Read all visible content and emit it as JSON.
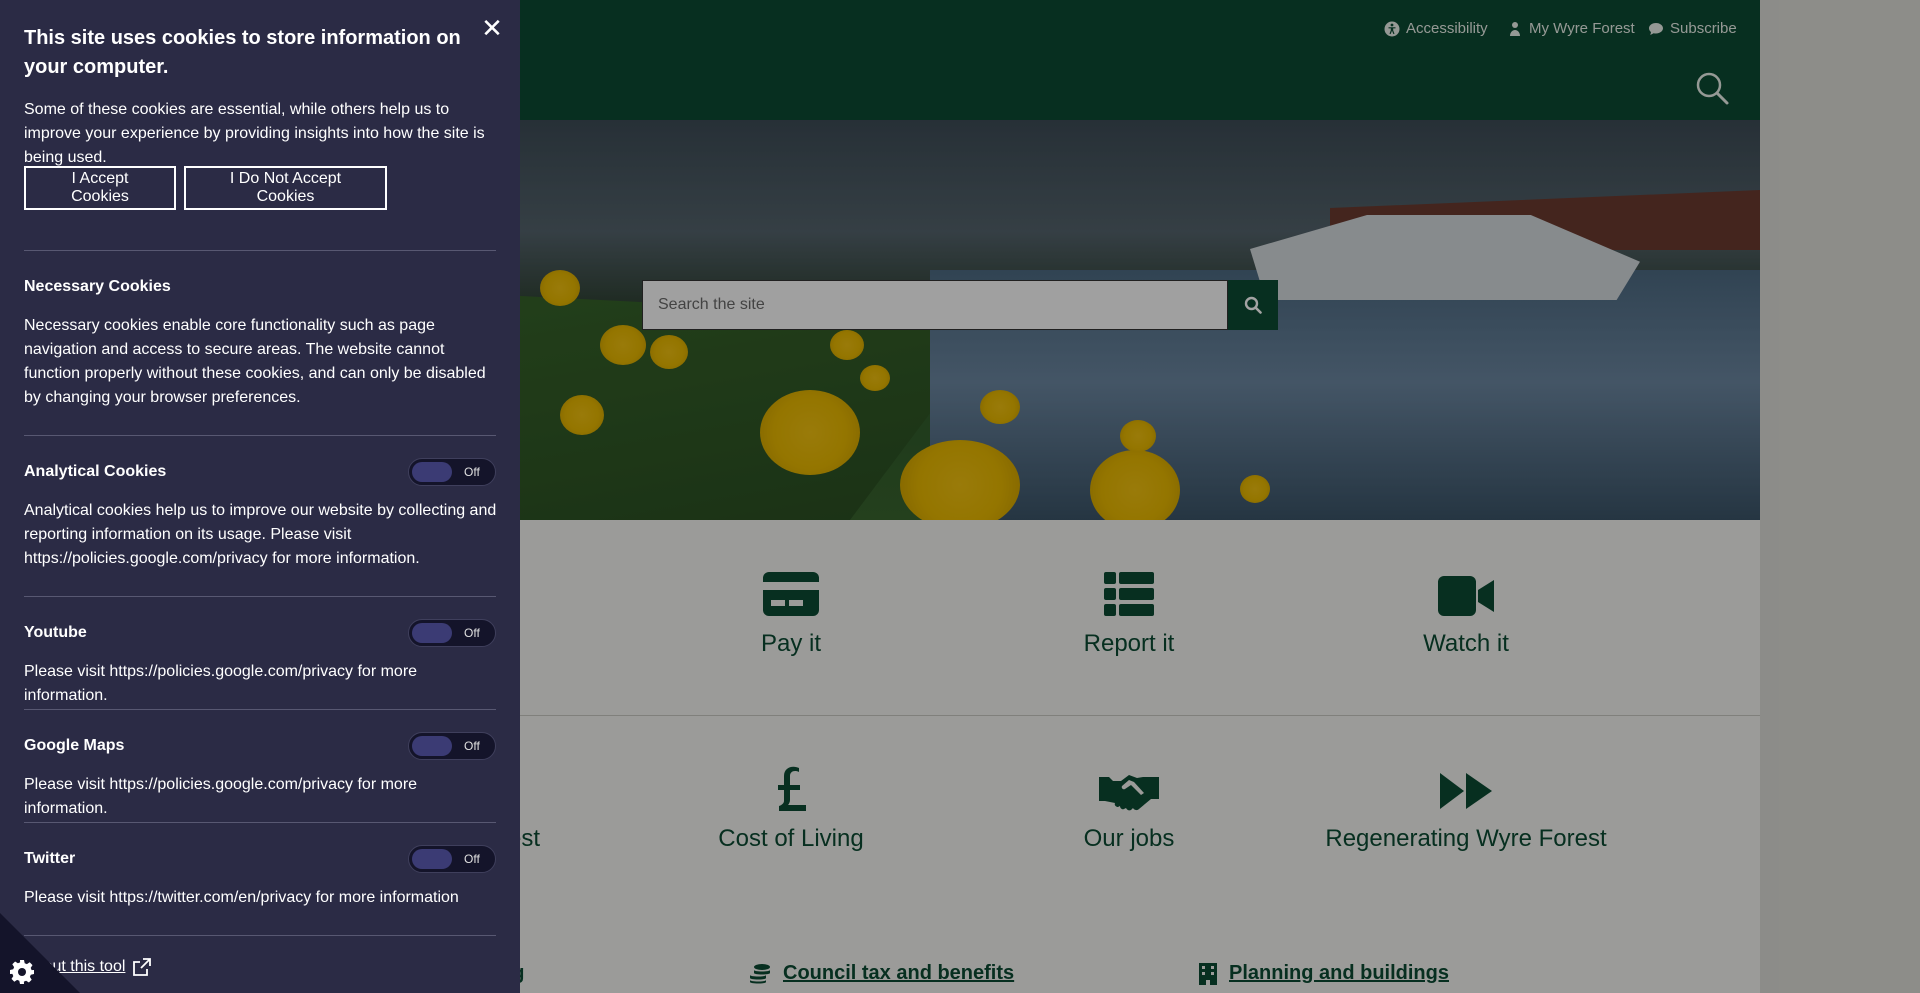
{
  "header": {
    "utility": [
      {
        "label": "Accessibility",
        "icon": "accessibility-icon"
      },
      {
        "label": "My Wyre Forest",
        "icon": "user-icon"
      },
      {
        "label": "Subscribe",
        "icon": "speech-bubble-icon"
      }
    ]
  },
  "hero": {
    "search_placeholder": "Search the site"
  },
  "quick_links": [
    {
      "label": "Pay it",
      "icon": "credit-card-icon"
    },
    {
      "label": "Report it",
      "icon": "list-icon"
    },
    {
      "label": "Watch it",
      "icon": "video-camera-icon"
    }
  ],
  "topics": [
    {
      "label": "est",
      "icon": ""
    },
    {
      "label": "Cost of Living",
      "icon": "pound-icon"
    },
    {
      "label": "Our jobs",
      "icon": "handshake-icon"
    },
    {
      "label": "Regenerating Wyre Forest",
      "icon": "fast-forward-icon"
    }
  ],
  "service_links": [
    {
      "label": "ng"
    },
    {
      "label": "Council tax and benefits",
      "icon": "coins-icon"
    },
    {
      "label": "Planning and buildings",
      "icon": "building-icon"
    }
  ],
  "cookie": {
    "title": "This site uses cookies to store information on your computer.",
    "intro": "Some of these cookies are essential, while others help us to improve your experience by providing insights into how the site is being used.",
    "accept_label": "I Accept Cookies",
    "reject_label": "I Do Not Accept Cookies",
    "necessary_title": "Necessary Cookies",
    "necessary_text": "Necessary cookies enable core functionality such as page navigation and access to secure areas. The website cannot function properly without these cookies, and can only be disabled by changing your browser preferences.",
    "sections": [
      {
        "title": "Analytical Cookies",
        "text": "Analytical cookies help us to improve our website by collecting and reporting information on its usage. Please visit https://policies.google.com/privacy for more information.",
        "state": "Off"
      },
      {
        "title": "Youtube",
        "text": "Please visit https://policies.google.com/privacy for more information.",
        "state": "Off"
      },
      {
        "title": "Google Maps",
        "text": "Please visit https://policies.google.com/privacy for more information.",
        "state": "Off"
      },
      {
        "title": "Twitter",
        "text": "Please visit https://twitter.com/en/privacy for more information",
        "state": "Off"
      }
    ],
    "about_label": "About this tool"
  },
  "colors": {
    "brand_green": "#0b4a32",
    "cookie_panel": "#2b2b45"
  }
}
